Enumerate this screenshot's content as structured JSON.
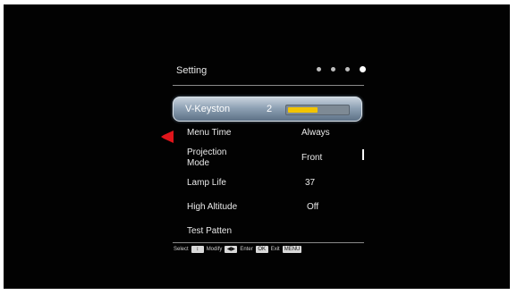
{
  "setting": {
    "title": "Setting",
    "dots_count": 4,
    "active_dot": 4
  },
  "selected": {
    "label": "V-Keyston",
    "value": "2",
    "level": 0.5
  },
  "menu": [
    {
      "label": "Menu Time",
      "value": "Always"
    },
    {
      "label": "Projection Mode",
      "value": "Front"
    },
    {
      "label": "Lamp Life",
      "value": "37"
    },
    {
      "label": "High Altitude",
      "value": "Off"
    },
    {
      "label": "Test Patten",
      "value": ""
    }
  ],
  "legend": {
    "select_label": "Select",
    "select_key": "↕",
    "modify_label": "Modify",
    "modify_key": "◀▶",
    "enter_label": "Enter",
    "enter_key": "OK",
    "exit_label": "Exit",
    "exit_key": "MENU"
  },
  "colors": {
    "accent_bar": "#f2c400",
    "left_arrow": "#e0151b",
    "selected_row": "#8fa2b5"
  }
}
